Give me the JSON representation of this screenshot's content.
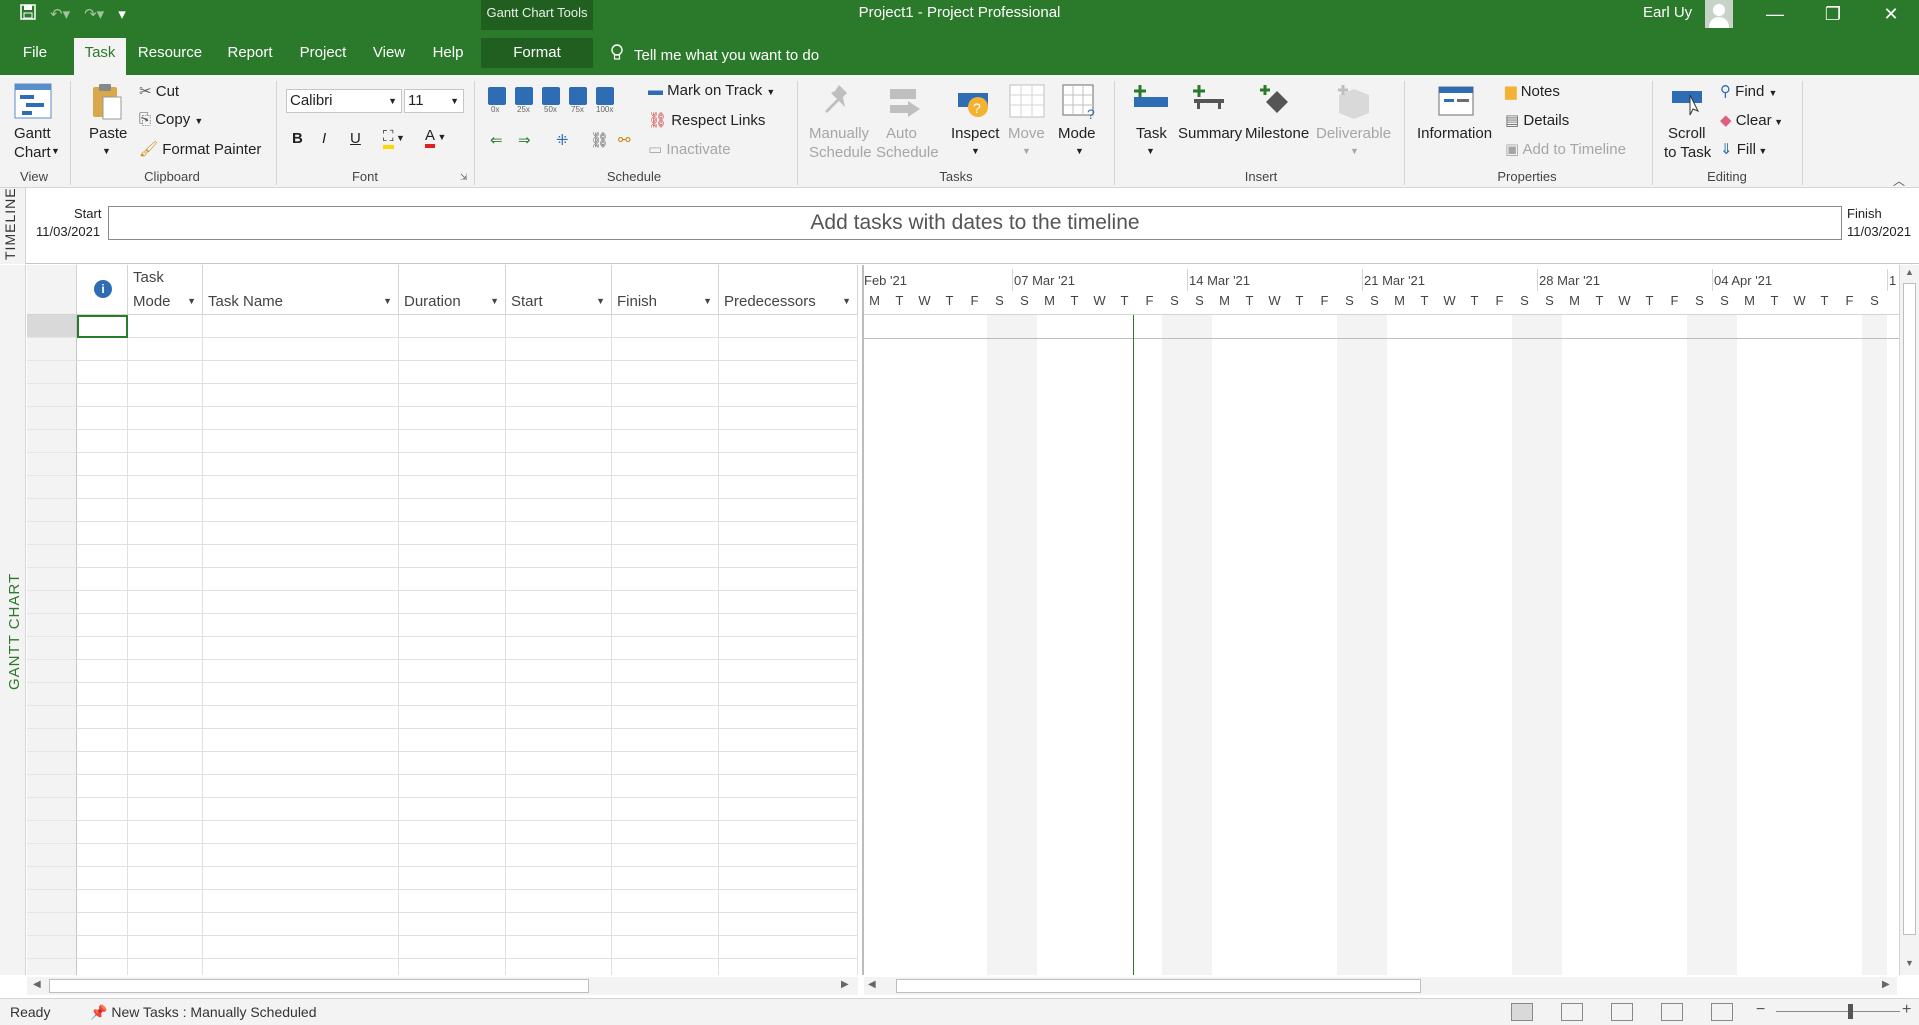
{
  "titlebar": {
    "title": "Project1  -  Project Professional",
    "context_group": "Gantt Chart Tools",
    "user": "Earl Uy",
    "qat_customize": "▾",
    "minimize": "—",
    "restore": "❐",
    "close": "✕"
  },
  "tabs": {
    "file": "File",
    "task": "Task",
    "resource": "Resource",
    "report": "Report",
    "project": "Project",
    "view": "View",
    "help": "Help",
    "format": "Format",
    "tell_me": "Tell me what you want to do"
  },
  "ribbon": {
    "view": {
      "gantt_chart": "Gantt",
      "gantt_chart2": "Chart",
      "label": "View"
    },
    "clipboard": {
      "paste": "Paste",
      "cut": "Cut",
      "copy": "Copy",
      "format_painter": "Format Painter",
      "label": "Clipboard"
    },
    "font": {
      "family": "Calibri",
      "size": "11",
      "bold": "B",
      "italic": "I",
      "underline": "U",
      "font_color": "A",
      "label": "Font"
    },
    "schedule": {
      "pct": [
        "0x",
        "25x",
        "50x",
        "75x",
        "100x"
      ],
      "mark_on_track": "Mark on Track",
      "respect_links": "Respect Links",
      "inactivate": "Inactivate",
      "label": "Schedule"
    },
    "tasks": {
      "manually": "Manually",
      "schedule1": "Schedule",
      "auto": "Auto",
      "schedule2": "Schedule",
      "inspect": "Inspect",
      "move": "Move",
      "mode": "Mode",
      "label": "Tasks"
    },
    "insert": {
      "task": "Task",
      "summary": "Summary",
      "milestone": "Milestone",
      "deliverable": "Deliverable",
      "label": "Insert"
    },
    "properties": {
      "information": "Information",
      "notes": "Notes",
      "details": "Details",
      "add_to_timeline": "Add to Timeline",
      "label": "Properties"
    },
    "editing": {
      "scroll": "Scroll",
      "to_task": "to Task",
      "find": "Find",
      "clear": "Clear",
      "fill": "Fill",
      "label": "Editing"
    }
  },
  "timeline": {
    "side_label": "TIMELINE",
    "start_label": "Start",
    "start_date": "11/03/2021",
    "finish_label": "Finish",
    "finish_date": "11/03/2021",
    "placeholder": "Add tasks with dates to the timeline"
  },
  "gantt": {
    "side_label": "GANTT CHART",
    "info_icon": "i",
    "columns": {
      "task_mode_1": "Task",
      "task_mode_2": "Mode",
      "task_name": "Task Name",
      "duration": "Duration",
      "start": "Start",
      "finish": "Finish",
      "predecessors": "Predecessors"
    },
    "weeks": [
      "Feb '21",
      "07 Mar '21",
      "14 Mar '21",
      "21 Mar '21",
      "28 Mar '21",
      "04 Apr '21",
      "1"
    ],
    "days": [
      "M",
      "T",
      "W",
      "T",
      "F",
      "S",
      "S",
      "M",
      "T",
      "W",
      "T",
      "F",
      "S",
      "S",
      "M",
      "T",
      "W",
      "T",
      "F",
      "S",
      "S",
      "M",
      "T",
      "W",
      "T",
      "F",
      "S",
      "S",
      "M",
      "T",
      "W",
      "T",
      "F",
      "S",
      "S",
      "M",
      "T",
      "W",
      "T",
      "F",
      "S"
    ]
  },
  "status": {
    "ready": "Ready",
    "new_tasks": "New Tasks : Manually Scheduled"
  },
  "colors": {
    "accent": "#2b7a2b",
    "ribbon_bg": "#f3f3f3"
  }
}
